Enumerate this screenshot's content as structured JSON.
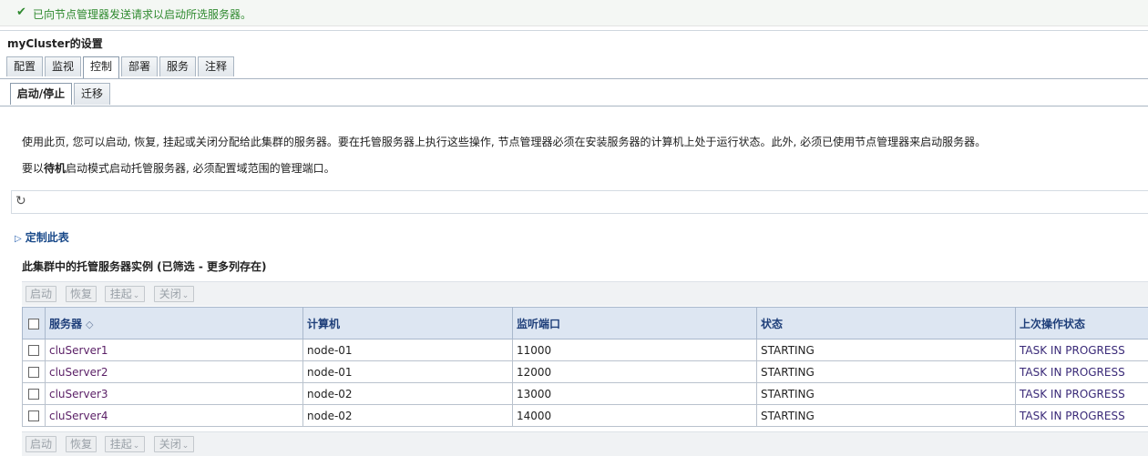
{
  "message": {
    "icon": "checkmark-icon",
    "text": "已向节点管理器发送请求以启动所选服务器。"
  },
  "panel_title": "myCluster的设置",
  "main_tabs": [
    {
      "label": "配置",
      "active": false
    },
    {
      "label": "监视",
      "active": false
    },
    {
      "label": "控制",
      "active": true
    },
    {
      "label": "部署",
      "active": false
    },
    {
      "label": "服务",
      "active": false
    },
    {
      "label": "注释",
      "active": false
    }
  ],
  "sub_tabs": [
    {
      "label": "启动/停止",
      "active": true
    },
    {
      "label": "迁移",
      "active": false
    }
  ],
  "description": {
    "line1": "使用此页, 您可以启动, 恢复, 挂起或关闭分配给此集群的服务器。要在托管服务器上执行这些操作, 节点管理器必须在安装服务器的计算机上处于运行状态。此外, 必须已使用节点管理器来启动服务器。",
    "line2_prefix": "要以",
    "line2_bold": "待机",
    "line2_suffix": "启动模式启动托管服务器, 必须配置域范围的管理端口。"
  },
  "refresh_icon": "refresh-icon",
  "customize_label": "定制此表",
  "table_caption": "此集群中的托管服务器实例 (已筛选 - 更多列存在)",
  "buttons": {
    "start": "启动",
    "resume": "恢复",
    "suspend": "挂起",
    "shutdown": "关闭"
  },
  "table": {
    "columns": [
      "服务器",
      "计算机",
      "监听端口",
      "状态",
      "上次操作状态"
    ],
    "sort_icon": "sort-ascending-icon",
    "rows": [
      {
        "server": "cluServer1",
        "machine": "node-01",
        "port": "11000",
        "state": "STARTING",
        "last_action": "TASK IN PROGRESS"
      },
      {
        "server": "cluServer2",
        "machine": "node-01",
        "port": "12000",
        "state": "STARTING",
        "last_action": "TASK IN PROGRESS"
      },
      {
        "server": "cluServer3",
        "machine": "node-02",
        "port": "13000",
        "state": "STARTING",
        "last_action": "TASK IN PROGRESS"
      },
      {
        "server": "cluServer4",
        "machine": "node-02",
        "port": "14000",
        "state": "STARTING",
        "last_action": "TASK IN PROGRESS"
      }
    ]
  },
  "colors": {
    "success_text": "#2f8a2f",
    "header_bg": "#dde6f2",
    "header_text": "#1f3f7a",
    "link": "#5a1f66"
  }
}
